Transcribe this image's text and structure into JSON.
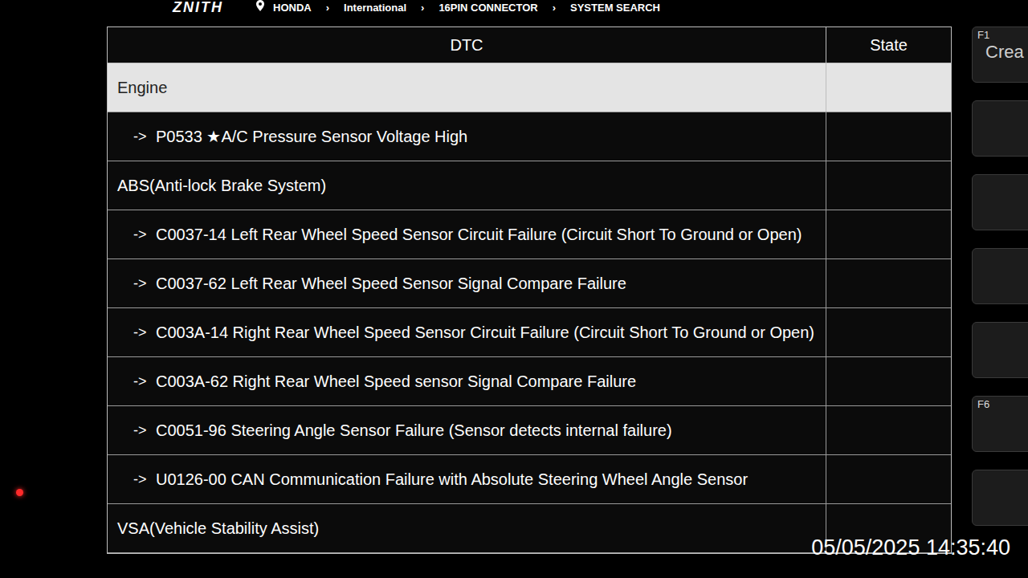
{
  "header": {
    "logo": "ZNITH",
    "separator": "›",
    "breadcrumb": [
      "HONDA",
      "International",
      "16PIN CONNECTOR",
      "SYSTEM SEARCH"
    ]
  },
  "table": {
    "columns": [
      "DTC",
      "State"
    ],
    "rows": [
      {
        "kind": "group",
        "text": "Engine",
        "state": "",
        "selected": true
      },
      {
        "kind": "code",
        "arrow": "->",
        "text": "P0533 ★A/C Pressure Sensor Voltage High",
        "state": "",
        "selected": false
      },
      {
        "kind": "group",
        "text": "ABS(Anti-lock Brake System)",
        "state": "",
        "selected": false
      },
      {
        "kind": "code",
        "arrow": "->",
        "text": "C0037-14 Left Rear Wheel Speed Sensor Circuit Failure (Circuit Short To Ground or Open)",
        "state": "",
        "selected": false
      },
      {
        "kind": "code",
        "arrow": "->",
        "text": "C0037-62 Left Rear Wheel Speed Sensor Signal Compare Failure",
        "state": "",
        "selected": false
      },
      {
        "kind": "code",
        "arrow": "->",
        "text": "C003A-14 Right Rear Wheel Speed Sensor Circuit Failure (Circuit Short To Ground or Open)",
        "state": "",
        "selected": false
      },
      {
        "kind": "code",
        "arrow": "->",
        "text": "C003A-62 Right Rear Wheel Speed sensor Signal Compare Failure",
        "state": "",
        "selected": false
      },
      {
        "kind": "code",
        "arrow": "->",
        "text": "C0051-96 Steering Angle Sensor Failure (Sensor detects internal failure)",
        "state": "",
        "selected": false
      },
      {
        "kind": "code",
        "arrow": "->",
        "text": "U0126-00 CAN Communication Failure with Absolute Steering Wheel Angle Sensor",
        "state": "",
        "selected": false
      },
      {
        "kind": "group",
        "text": "VSA(Vehicle Stability Assist)",
        "state": "",
        "selected": false
      }
    ]
  },
  "side_buttons": [
    {
      "key": "F1",
      "label": "Crea"
    },
    {
      "key": "",
      "label": ""
    },
    {
      "key": "",
      "label": ""
    },
    {
      "key": "",
      "label": ""
    },
    {
      "key": "",
      "label": ""
    },
    {
      "key": "F6",
      "label": ""
    },
    {
      "key": "",
      "label": ""
    }
  ],
  "watermark": "05/05/2025 14:35:40"
}
